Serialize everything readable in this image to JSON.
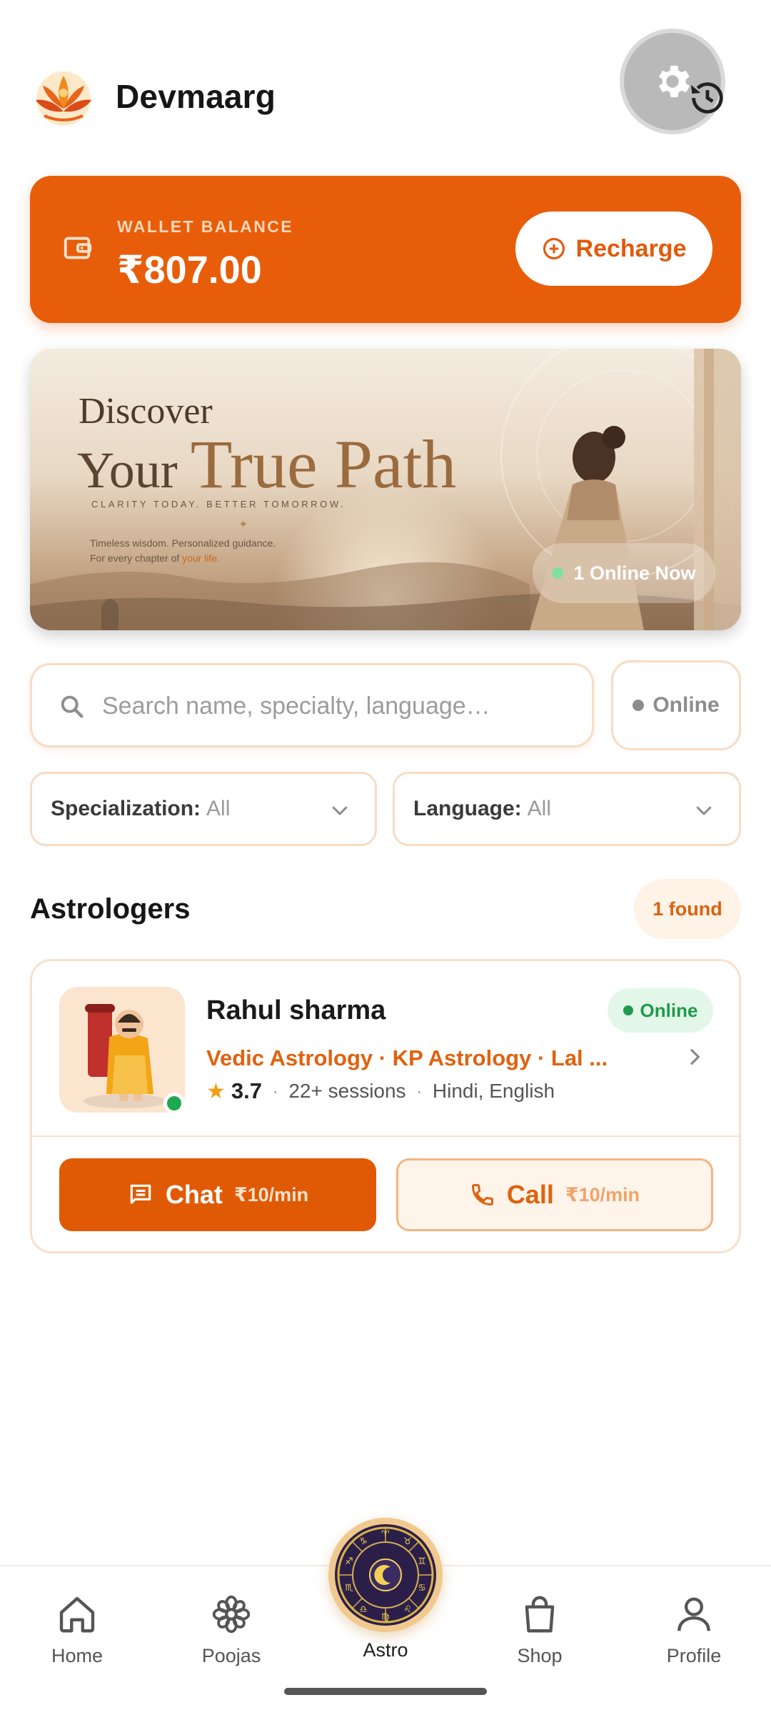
{
  "header": {
    "app_title": "Devmaarg",
    "logo_icon": "lotus-logo-icon",
    "settings_icon": "gear-icon",
    "history_icon": "history-icon"
  },
  "wallet": {
    "label": "WALLET BALANCE",
    "amount": "₹807.00",
    "recharge_label": "Recharge",
    "accent_color": "#e85d0a"
  },
  "banner": {
    "line1": "Discover",
    "line2_a": "Your",
    "line2_b": "True Path",
    "tagline": "CLARITY TODAY. BETTER TOMORROW.",
    "sub1": "Timeless wisdom. Personalized guidance.",
    "sub2_a": "For every chapter of",
    "sub2_b": "your life.",
    "online_now": "1 Online Now"
  },
  "search": {
    "placeholder": "Search name, specialty, language…",
    "online_filter": "Online"
  },
  "filters": {
    "specialization_label": "Specialization:",
    "specialization_value": "All",
    "language_label": "Language:",
    "language_value": "All"
  },
  "section": {
    "title": "Astrologers",
    "found": "1 found"
  },
  "astrologers": [
    {
      "name": "Rahul sharma",
      "status": "Online",
      "specialties": "Vedic Astrology · KP Astrology · Lal ...",
      "rating": "3.7",
      "sessions": "22+ sessions",
      "languages": "Hindi, English",
      "chat_label": "Chat",
      "chat_price": "₹10/min",
      "call_label": "Call",
      "call_price": "₹10/min"
    }
  ],
  "nav": {
    "items": [
      {
        "label": "Home",
        "icon": "home-icon"
      },
      {
        "label": "Poojas",
        "icon": "flower-icon"
      },
      {
        "label": "Astro",
        "icon": "zodiac-wheel-icon"
      },
      {
        "label": "Shop",
        "icon": "shopping-bag-icon"
      },
      {
        "label": "Profile",
        "icon": "user-icon"
      }
    ]
  },
  "colors": {
    "brand_orange": "#e05a05",
    "online_green": "#1ea84f"
  }
}
